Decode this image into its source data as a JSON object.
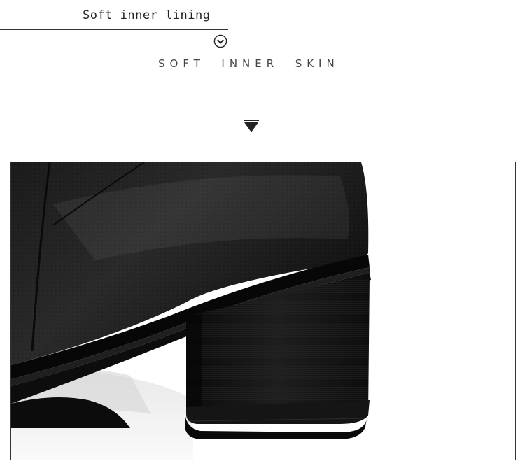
{
  "header": {
    "title": "Soft inner lining"
  },
  "section": {
    "subtitle": "SOFT  INNER  SKIN"
  },
  "icons": {
    "circle_chevron": "chevron-down-circle-icon",
    "arrow_down": "triangle-down-icon"
  },
  "image": {
    "subject": "boot-heel-photo"
  },
  "colors": {
    "text": "#222222",
    "leather": "#141414",
    "background": "#ffffff"
  }
}
